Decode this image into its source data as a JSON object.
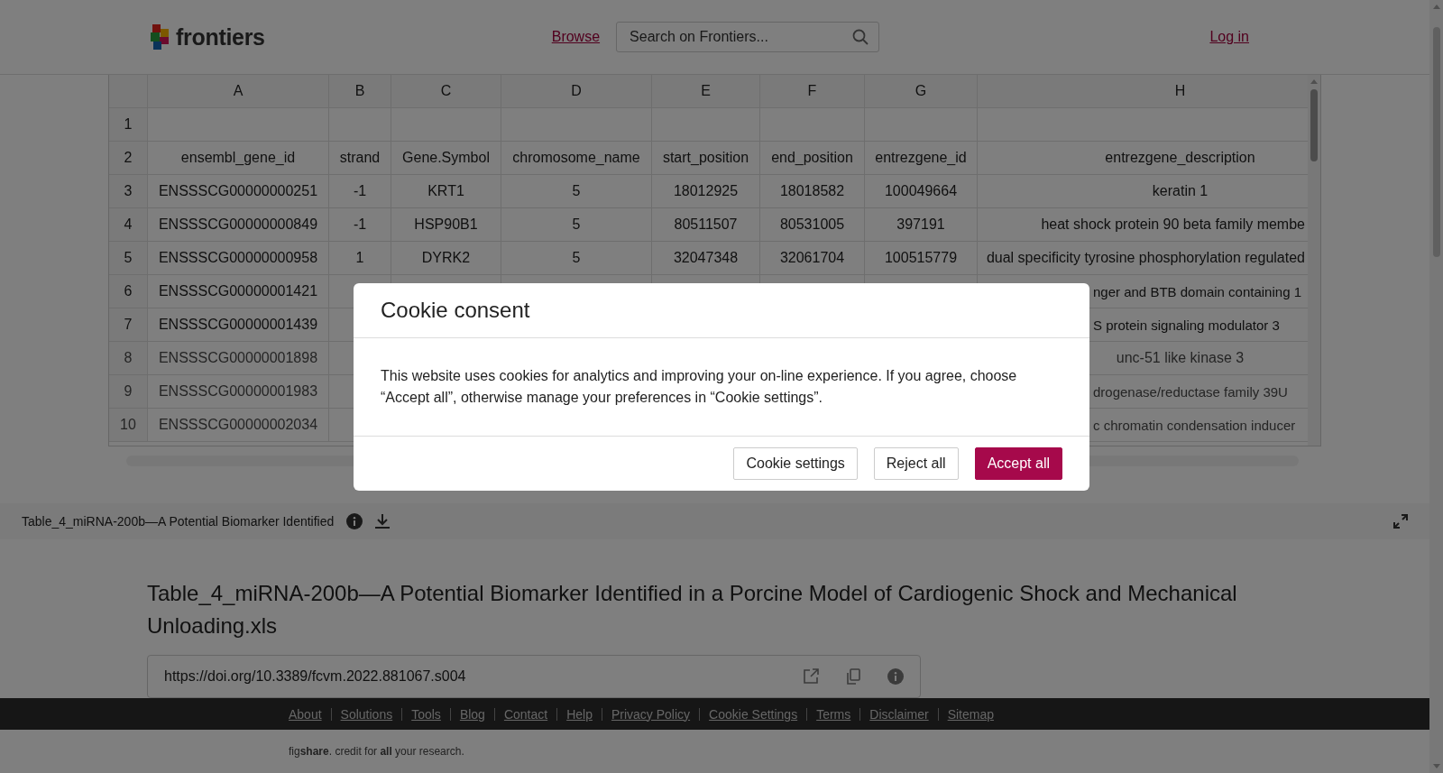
{
  "header": {
    "logo_text": "frontiers",
    "browse": "Browse",
    "search": {
      "placeholder": "Search on Frontiers..."
    },
    "login": "Log in"
  },
  "spreadsheet": {
    "columns": [
      "A",
      "B",
      "C",
      "D",
      "E",
      "F",
      "G",
      "H"
    ],
    "rows": [
      {
        "number": "1",
        "faded": false
      },
      {
        "number": "2",
        "cells": [
          "ensembl_gene_id",
          "strand",
          "Gene.Symbol",
          "chromosome_name",
          "start_position",
          "end_position",
          "entrezgene_id",
          "entrezgene_description"
        ],
        "faded": false
      },
      {
        "number": "3",
        "cells": [
          "ENSSSCG00000000251",
          "-1",
          "KRT1",
          "5",
          "18012925",
          "18018582",
          "100049664",
          "keratin 1"
        ],
        "faded": false
      },
      {
        "number": "4",
        "cells": [
          "ENSSSCG00000000849",
          "-1",
          "HSP90B1",
          "5",
          "80511507",
          "80531005",
          "397191",
          "heat shock protein 90 beta family membe"
        ],
        "kind": "cut_right",
        "faded": false
      },
      {
        "number": "5",
        "cells": [
          "ENSSSCG00000000958",
          "1",
          "DYRK2",
          "5",
          "32047348",
          "32061704",
          "100515779",
          "dual specificity tyrosine phosphorylation regulated"
        ],
        "kind": "cut_right",
        "faded": false
      },
      {
        "number": "6",
        "cells": [
          "ENSSSCG00000001421",
          null,
          null,
          null,
          null,
          null,
          null,
          "nger and BTB domain containing 1"
        ],
        "kind": "cut_left",
        "faded": false
      },
      {
        "number": "7",
        "cells": [
          "ENSSSCG00000001439",
          null,
          null,
          null,
          null,
          null,
          null,
          "S protein signaling modulator 3"
        ],
        "kind": "cut_left",
        "faded": false
      },
      {
        "number": "8",
        "cells": [
          "ENSSSCG00000001898",
          null,
          null,
          null,
          null,
          null,
          null,
          "unc-51 like kinase 3"
        ],
        "faded": true
      },
      {
        "number": "9",
        "cells": [
          "ENSSSCG00000001983",
          null,
          null,
          null,
          null,
          null,
          null,
          "drogenase/reductase family 39U"
        ],
        "kind": "cut_left",
        "faded": true
      },
      {
        "number": "10",
        "cells": [
          "ENSSSCG00000002034",
          null,
          null,
          null,
          null,
          null,
          null,
          "c chromatin condensation inducer"
        ],
        "kind": "cut_left",
        "faded": true
      }
    ]
  },
  "figure_bar": {
    "caption": "Table_4_miRNA-200b—A Potential Biomarker Identified"
  },
  "article": {
    "title": "Table_4_miRNA-200b—A Potential Biomarker Identified in a Porcine Model of Cardiogenic Shock and Mechanical Unloading.xls",
    "doi": "https://doi.org/10.3389/fcvm.2022.881067.s004"
  },
  "footer": {
    "links": [
      "About",
      "Solutions",
      "Tools",
      "Blog",
      "Contact",
      "Help",
      "Privacy Policy",
      "Cookie Settings",
      "Terms",
      "Disclaimer",
      "Sitemap"
    ],
    "tagline": "fig**share**. credit for **all** your research."
  },
  "cookie_dialog": {
    "title": "Cookie consent",
    "message": "This website uses cookies for analytics and improving your on-line experience. If you agree, choose “Accept all”, otherwise manage your preferences in “Cookie settings”.",
    "buttons": [
      {
        "label": "Cookie settings",
        "kind": "secondary"
      },
      {
        "label": "Reject all",
        "kind": "secondary"
      },
      {
        "label": "Accept all",
        "kind": "primary"
      }
    ]
  }
}
